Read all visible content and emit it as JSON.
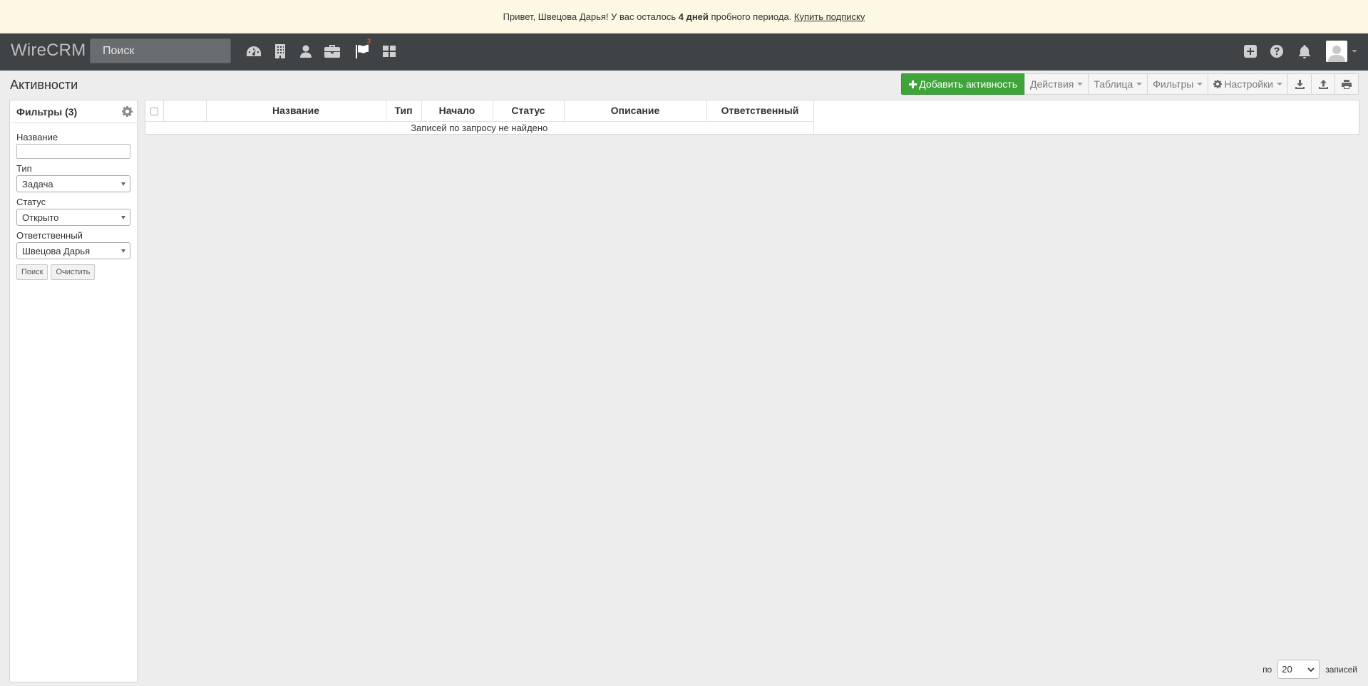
{
  "banner": {
    "greeting": "Привет, Швецова Дарья! У вас осталось ",
    "days": "4 дней",
    "after": " пробного периода. ",
    "link": "Купить подписку"
  },
  "navbar": {
    "brand": "WireCRM",
    "search_placeholder": "Поиск",
    "flag_badge": "3",
    "icons": [
      "dashboard-icon",
      "building-icon",
      "user-icon",
      "briefcase-icon",
      "flag-icon",
      "grid-icon",
      "plus-square-icon",
      "help-icon",
      "bell-icon",
      "avatar"
    ]
  },
  "page": {
    "title": "Активности"
  },
  "toolbar": {
    "add_label": "Добавить активность",
    "actions_label": "Действия",
    "table_label": "Таблица",
    "filters_label": "Фильтры",
    "settings_label": "Настройки"
  },
  "filters": {
    "title": "Фильтры (3)",
    "name_label": "Название",
    "name_value": "",
    "type_label": "Тип",
    "type_value": "Задача",
    "status_label": "Статус",
    "status_value": "Открыто",
    "owner_label": "Ответственный",
    "owner_value": "Швецова Дарья",
    "search_button": "Поиск",
    "clear_button": "Очистить"
  },
  "table": {
    "columns": [
      "Название",
      "Тип",
      "Начало",
      "Статус",
      "Описание",
      "Ответственный"
    ],
    "empty_message": "Записей по запросу не найдено"
  },
  "pager": {
    "prefix": "по",
    "per_page": "20",
    "suffix": "записей"
  },
  "colors": {
    "navbar": "#3f4346",
    "banner": "#fcf8e3",
    "primary": "#3fa53b"
  }
}
